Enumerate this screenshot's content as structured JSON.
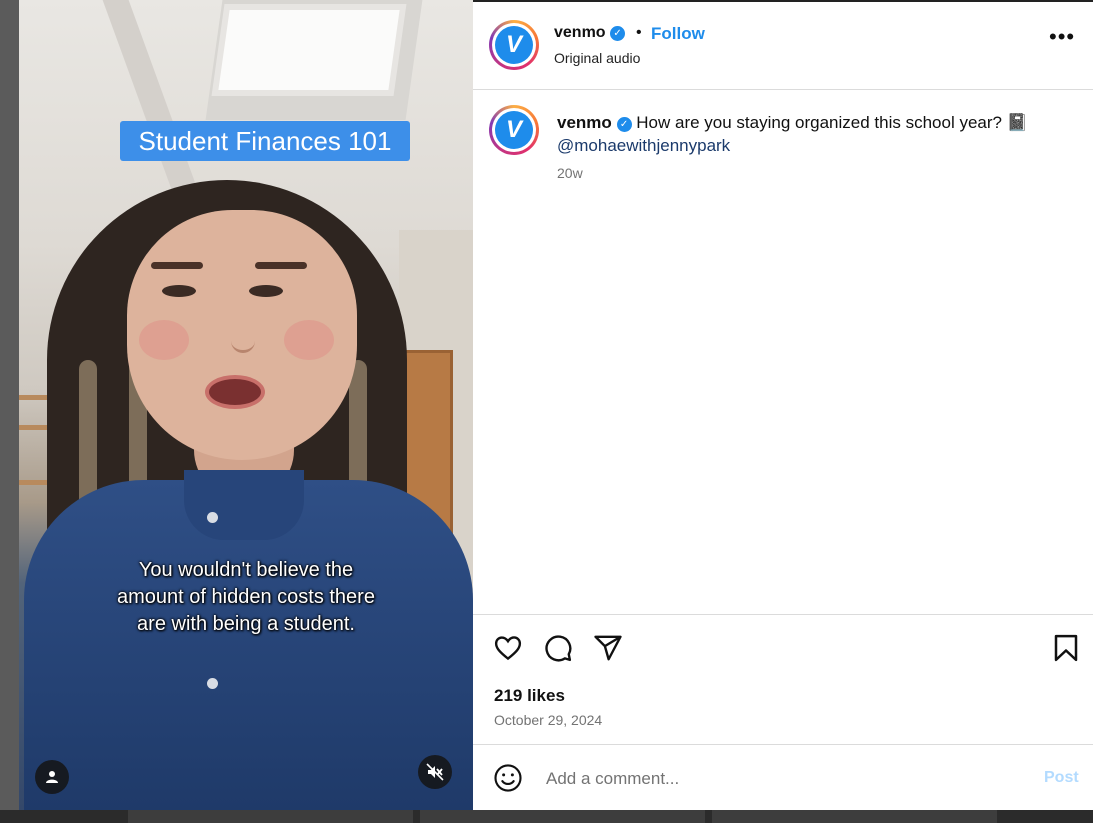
{
  "video": {
    "title_overlay": "Student Finances 101",
    "caption_overlay": "You wouldn't believe the amount of hidden costs there are with being a student.",
    "account_button_icon": "person-icon",
    "mute_button_icon": "muted-speaker-icon"
  },
  "post": {
    "username": "venmo",
    "verified": true,
    "follow_label": "Follow",
    "separator": "•",
    "audio_label": "Original audio",
    "more_icon": "more-options-icon",
    "more_label": "•••",
    "accent_color": "#1e8ceb"
  },
  "caption": {
    "username": "venmo",
    "text": "How are you staying organized this school year? 📓",
    "mention": "@mohaewithjennypark",
    "time_ago": "20w"
  },
  "actions": {
    "icons": [
      "heart-icon",
      "comment-icon",
      "share-icon",
      "bookmark-icon"
    ],
    "likes": "219 likes",
    "date": "October 29, 2024"
  },
  "comment": {
    "emoji_icon": "emoji-icon",
    "placeholder": "Add a comment...",
    "post_label": "Post"
  }
}
